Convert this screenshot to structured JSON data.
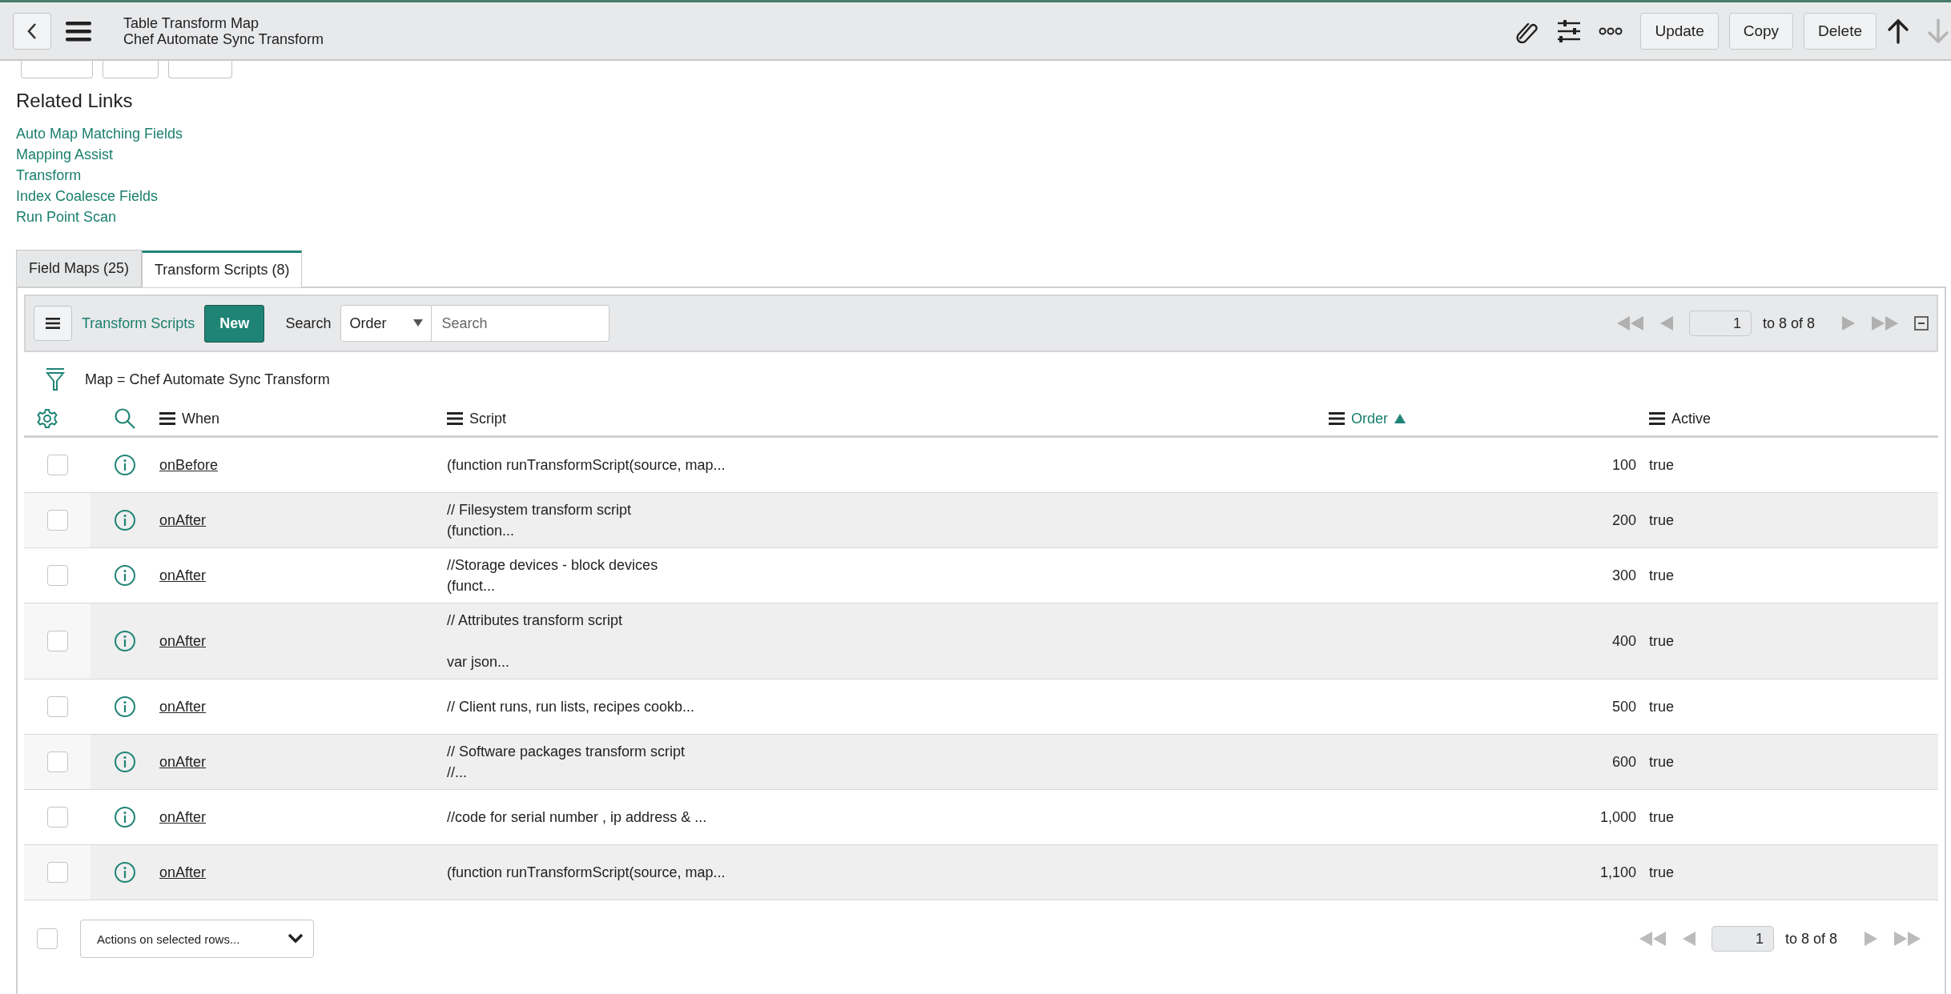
{
  "header": {
    "title": "Table Transform Map",
    "subtitle": "Chef Automate Sync Transform",
    "buttons": [
      "Update",
      "Copy",
      "Delete"
    ],
    "record_nav": [
      {
        "kind": "up",
        "disabled": false
      },
      {
        "kind": "down",
        "disabled": true
      }
    ]
  },
  "related_links": {
    "title": "Related Links",
    "links": [
      "Auto Map Matching Fields",
      "Mapping Assist",
      "Transform",
      "Index Coalesce Fields",
      "Run Point Scan"
    ]
  },
  "tabs": [
    {
      "label": "Field Maps (25)",
      "selected": false
    },
    {
      "label": "Transform Scripts (8)",
      "selected": true
    }
  ],
  "list": {
    "title": "Transform Scripts",
    "new_button": "New",
    "search_label": "Search",
    "search_field": "Order",
    "search_placeholder": "Search",
    "pager": {
      "page": "1",
      "range": "to 8 of 8"
    },
    "filter": "Map = Chef Automate Sync Transform",
    "columns": [
      {
        "label": "When",
        "sorted": false
      },
      {
        "label": "Script",
        "sorted": false
      },
      {
        "label": "Order",
        "sorted": true
      },
      {
        "label": "Active",
        "sorted": false
      }
    ],
    "rows": [
      {
        "checked": false,
        "when": "onBefore",
        "script": "(function runTransformScript(source, map...",
        "order": "100",
        "active": "true"
      },
      {
        "checked": false,
        "when": "onAfter",
        "script": "// Filesystem transform script\n(function...",
        "order": "200",
        "active": "true"
      },
      {
        "checked": false,
        "when": "onAfter",
        "script": "//Storage devices - block devices\n(funct...",
        "order": "300",
        "active": "true"
      },
      {
        "checked": false,
        "when": "onAfter",
        "script": "// Attributes transform script\n\nvar json...",
        "order": "400",
        "active": "true"
      },
      {
        "checked": false,
        "when": "onAfter",
        "script": "// Client runs, run lists, recipes cookb...",
        "order": "500",
        "active": "true"
      },
      {
        "checked": false,
        "when": "onAfter",
        "script": "// Software packages transform script\n//...",
        "order": "600",
        "active": "true"
      },
      {
        "checked": false,
        "when": "onAfter",
        "script": "//code for serial number , ip address & ...",
        "order": "1,000",
        "active": "true"
      },
      {
        "checked": false,
        "when": "onAfter",
        "script": "(function runTransformScript(source, map...",
        "order": "1,100",
        "active": "true"
      }
    ],
    "footer": {
      "select_all_checked": false,
      "actions_placeholder": "Actions on selected rows...",
      "pager": {
        "page": "1",
        "range": "to 8 of 8"
      }
    }
  }
}
